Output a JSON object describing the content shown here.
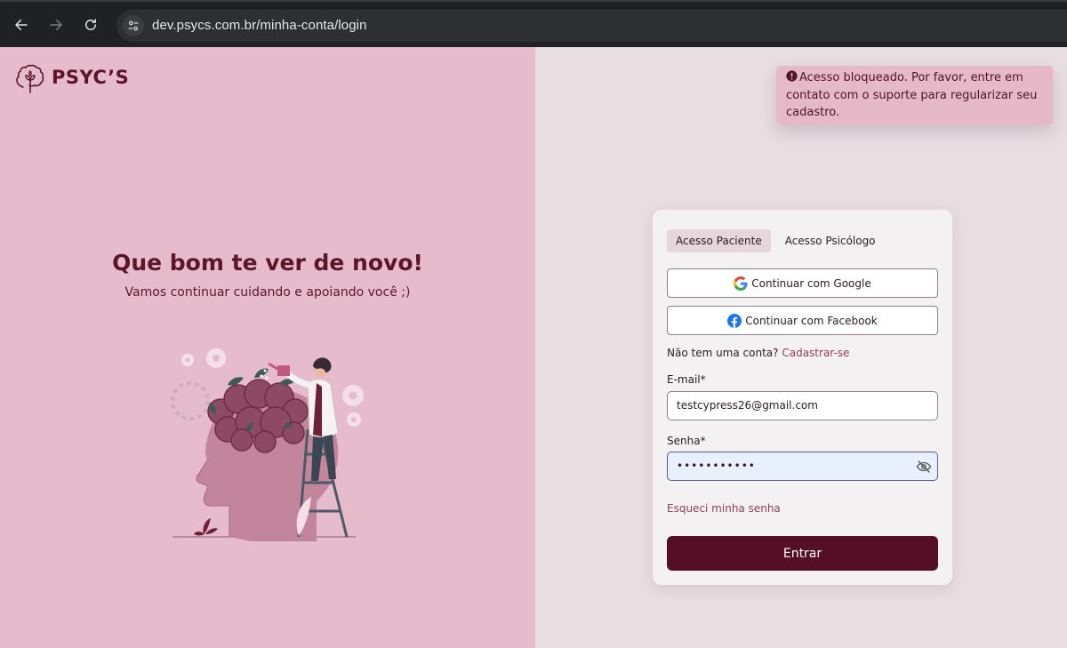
{
  "browser": {
    "url": "dev.psycs.com.br/minha-conta/login"
  },
  "brand": {
    "name": "PSYC’S"
  },
  "hero": {
    "title": "Que bom te ver de novo!",
    "subtitle": "Vamos continuar cuidando e apoiando você ;)"
  },
  "toast": {
    "message": "Acesso bloqueado. Por favor, entre em contato com o suporte para regularizar seu cadastro."
  },
  "login": {
    "tabs": [
      {
        "label": "Acesso Paciente",
        "active": true
      },
      {
        "label": "Acesso Psicólogo",
        "active": false
      }
    ],
    "google_label": "Continuar com Google",
    "facebook_label": "Continuar com Facebook",
    "signup_prompt": "Não tem uma conta?",
    "signup_link": "Cadastrar-se",
    "email_label": "E-mail*",
    "email_value": "testcypress26@gmail.com",
    "password_label": "Senha*",
    "password_value": "•••••••••••",
    "forgot_label": "Esqueci minha senha",
    "submit_label": "Entrar"
  },
  "colors": {
    "brand_dark": "#540f26",
    "left_panel": "#e6bccc",
    "right_panel": "#e8dde1",
    "toast_bg": "#e6b9c9",
    "link": "#8e3d5a"
  },
  "icons": {
    "back": "arrow-left-icon",
    "forward": "arrow-right-icon",
    "reload": "reload-icon",
    "site_info": "tune-icon",
    "logo": "brain-flower-icon",
    "alert": "alert-circle-icon",
    "google": "google-icon",
    "facebook": "facebook-icon",
    "password_toggle": "eye-off-icon"
  }
}
